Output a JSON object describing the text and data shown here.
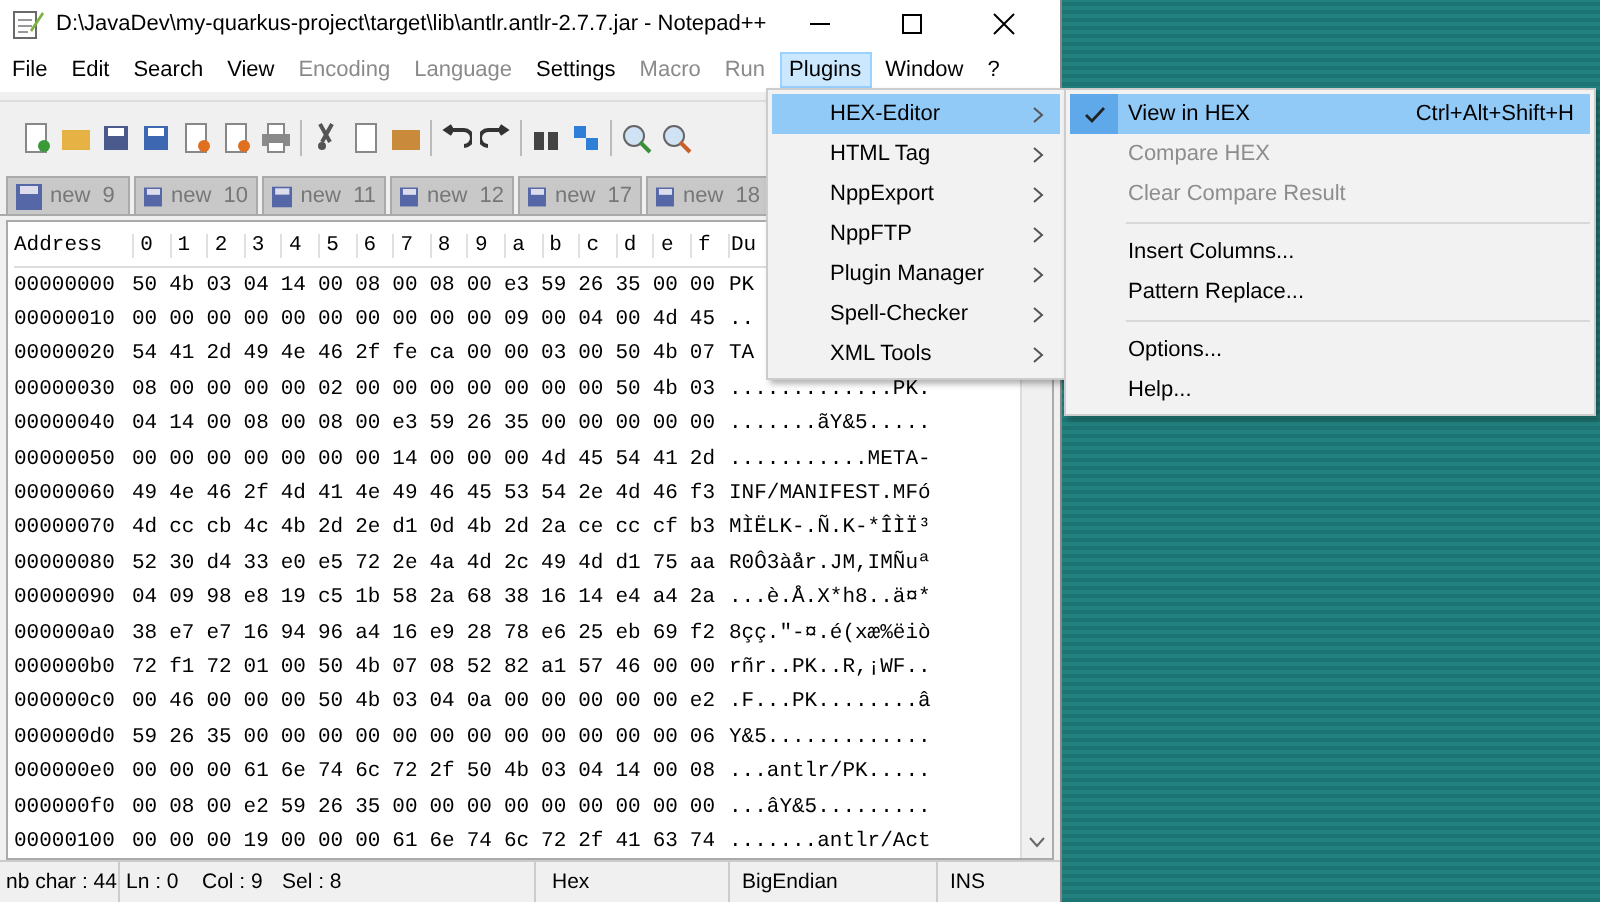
{
  "window": {
    "title": "D:\\JavaDev\\my-quarkus-project\\target\\lib\\antlr.antlr-2.7.7.jar - Notepad++"
  },
  "menu_bar": [
    {
      "label": "File",
      "disabled": false,
      "selected": false
    },
    {
      "label": "Edit",
      "disabled": false,
      "selected": false
    },
    {
      "label": "Search",
      "disabled": false,
      "selected": false
    },
    {
      "label": "View",
      "disabled": false,
      "selected": false
    },
    {
      "label": "Encoding",
      "disabled": true,
      "selected": false
    },
    {
      "label": "Language",
      "disabled": true,
      "selected": false
    },
    {
      "label": "Settings",
      "disabled": false,
      "selected": false
    },
    {
      "label": "Macro",
      "disabled": true,
      "selected": false
    },
    {
      "label": "Run",
      "disabled": true,
      "selected": false
    },
    {
      "label": "Plugins",
      "disabled": false,
      "selected": true
    },
    {
      "label": "Window",
      "disabled": false,
      "selected": false
    },
    {
      "label": "?",
      "disabled": false,
      "selected": false
    }
  ],
  "tabs": [
    {
      "label": "new  9",
      "selected": false
    },
    {
      "label": "new  10",
      "selected": false
    },
    {
      "label": "new  11",
      "selected": false
    },
    {
      "label": "new  12",
      "selected": false
    },
    {
      "label": "new  17",
      "selected": false
    },
    {
      "label": "new  18",
      "selected": false
    }
  ],
  "hex_view": {
    "columns": [
      "Address",
      "0",
      "1",
      "2",
      "3",
      "4",
      "5",
      "6",
      "7",
      "8",
      "9",
      "a",
      "b",
      "c",
      "d",
      "e",
      "f",
      "Du"
    ],
    "rows": [
      {
        "address": "00000000",
        "bytes": [
          "50",
          "4b",
          "03",
          "04",
          "14",
          "00",
          "08",
          "00",
          "08",
          "00",
          "e3",
          "59",
          "26",
          "35",
          "00",
          "00"
        ],
        "dump": "PK"
      },
      {
        "address": "00000010",
        "bytes": [
          "00",
          "00",
          "00",
          "00",
          "00",
          "00",
          "00",
          "00",
          "00",
          "00",
          "09",
          "00",
          "04",
          "00",
          "4d",
          "45"
        ],
        "dump": ".."
      },
      {
        "address": "00000020",
        "bytes": [
          "54",
          "41",
          "2d",
          "49",
          "4e",
          "46",
          "2f",
          "fe",
          "ca",
          "00",
          "00",
          "03",
          "00",
          "50",
          "4b",
          "07"
        ],
        "dump": "TA"
      },
      {
        "address": "00000030",
        "bytes": [
          "08",
          "00",
          "00",
          "00",
          "00",
          "02",
          "00",
          "00",
          "00",
          "00",
          "00",
          "00",
          "00",
          "50",
          "4b",
          "03"
        ],
        "dump": ".............PK."
      },
      {
        "address": "00000040",
        "bytes": [
          "04",
          "14",
          "00",
          "08",
          "00",
          "08",
          "00",
          "e3",
          "59",
          "26",
          "35",
          "00",
          "00",
          "00",
          "00",
          "00"
        ],
        "dump": ".......ãY&5....."
      },
      {
        "address": "00000050",
        "bytes": [
          "00",
          "00",
          "00",
          "00",
          "00",
          "00",
          "00",
          "14",
          "00",
          "00",
          "00",
          "4d",
          "45",
          "54",
          "41",
          "2d"
        ],
        "dump": "...........META-"
      },
      {
        "address": "00000060",
        "bytes": [
          "49",
          "4e",
          "46",
          "2f",
          "4d",
          "41",
          "4e",
          "49",
          "46",
          "45",
          "53",
          "54",
          "2e",
          "4d",
          "46",
          "f3"
        ],
        "dump": "INF/MANIFEST.MFó"
      },
      {
        "address": "00000070",
        "bytes": [
          "4d",
          "cc",
          "cb",
          "4c",
          "4b",
          "2d",
          "2e",
          "d1",
          "0d",
          "4b",
          "2d",
          "2a",
          "ce",
          "cc",
          "cf",
          "b3"
        ],
        "dump": "MÌËLK-.Ñ.K-*ÎÌÏ³"
      },
      {
        "address": "00000080",
        "bytes": [
          "52",
          "30",
          "d4",
          "33",
          "e0",
          "e5",
          "72",
          "2e",
          "4a",
          "4d",
          "2c",
          "49",
          "4d",
          "d1",
          "75",
          "aa"
        ],
        "dump": "R0Ô3àår.JM,IMÑuª"
      },
      {
        "address": "00000090",
        "bytes": [
          "04",
          "09",
          "98",
          "e8",
          "19",
          "c5",
          "1b",
          "58",
          "2a",
          "68",
          "38",
          "16",
          "14",
          "e4",
          "a4",
          "2a"
        ],
        "dump": "...è.Å.X*h8..ä¤*"
      },
      {
        "address": "000000a0",
        "bytes": [
          "38",
          "e7",
          "e7",
          "16",
          "94",
          "96",
          "a4",
          "16",
          "e9",
          "28",
          "78",
          "e6",
          "25",
          "eb",
          "69",
          "f2"
        ],
        "dump": "8çç.″-¤.é(xæ%ëiò"
      },
      {
        "address": "000000b0",
        "bytes": [
          "72",
          "f1",
          "72",
          "01",
          "00",
          "50",
          "4b",
          "07",
          "08",
          "52",
          "82",
          "a1",
          "57",
          "46",
          "00",
          "00"
        ],
        "dump": "rñr..PK..R,¡WF.."
      },
      {
        "address": "000000c0",
        "bytes": [
          "00",
          "46",
          "00",
          "00",
          "00",
          "50",
          "4b",
          "03",
          "04",
          "0a",
          "00",
          "00",
          "00",
          "00",
          "00",
          "e2"
        ],
        "dump": ".F...PK........â"
      },
      {
        "address": "000000d0",
        "bytes": [
          "59",
          "26",
          "35",
          "00",
          "00",
          "00",
          "00",
          "00",
          "00",
          "00",
          "00",
          "00",
          "00",
          "00",
          "00",
          "06"
        ],
        "dump": "Y&5............."
      },
      {
        "address": "000000e0",
        "bytes": [
          "00",
          "00",
          "00",
          "61",
          "6e",
          "74",
          "6c",
          "72",
          "2f",
          "50",
          "4b",
          "03",
          "04",
          "14",
          "00",
          "08"
        ],
        "dump": "...antlr/PK....."
      },
      {
        "address": "000000f0",
        "bytes": [
          "00",
          "08",
          "00",
          "e2",
          "59",
          "26",
          "35",
          "00",
          "00",
          "00",
          "00",
          "00",
          "00",
          "00",
          "00",
          "00"
        ],
        "dump": "...âY&5........."
      },
      {
        "address": "00000100",
        "bytes": [
          "00",
          "00",
          "00",
          "19",
          "00",
          "00",
          "00",
          "61",
          "6e",
          "74",
          "6c",
          "72",
          "2f",
          "41",
          "63",
          "74"
        ],
        "dump": ".......antlr/Act"
      }
    ]
  },
  "plugins_menu": [
    {
      "label": "HEX-Editor",
      "selected": true
    },
    {
      "label": "HTML Tag",
      "selected": false
    },
    {
      "label": "NppExport",
      "selected": false
    },
    {
      "label": "NppFTP",
      "selected": false
    },
    {
      "label": "Plugin Manager",
      "selected": false
    },
    {
      "label": "Spell-Checker",
      "selected": false
    },
    {
      "label": "XML Tools",
      "selected": false
    }
  ],
  "hex_editor_menu": [
    {
      "kind": "item",
      "label": "View in HEX",
      "shortcut": "Ctrl+Alt+Shift+H",
      "checked": true,
      "disabled": false,
      "selected": true
    },
    {
      "kind": "item",
      "label": "Compare HEX",
      "checked": false,
      "disabled": true,
      "selected": false
    },
    {
      "kind": "item",
      "label": "Clear Compare Result",
      "checked": false,
      "disabled": true,
      "selected": false
    },
    {
      "kind": "separator"
    },
    {
      "kind": "item",
      "label": "Insert Columns...",
      "checked": false,
      "disabled": false,
      "selected": false
    },
    {
      "kind": "item",
      "label": "Pattern Replace...",
      "checked": false,
      "disabled": false,
      "selected": false
    },
    {
      "kind": "separator"
    },
    {
      "kind": "item",
      "label": "Options...",
      "checked": false,
      "disabled": false,
      "selected": false
    },
    {
      "kind": "item",
      "label": "Help...",
      "checked": false,
      "disabled": false,
      "selected": false
    }
  ],
  "status_bar": {
    "chars": "nb char : 44",
    "line": "Ln : 0",
    "column": "Col : 9",
    "selection": "Sel : 8",
    "mode": "Hex",
    "endian": "BigEndian",
    "insert": "INS"
  }
}
